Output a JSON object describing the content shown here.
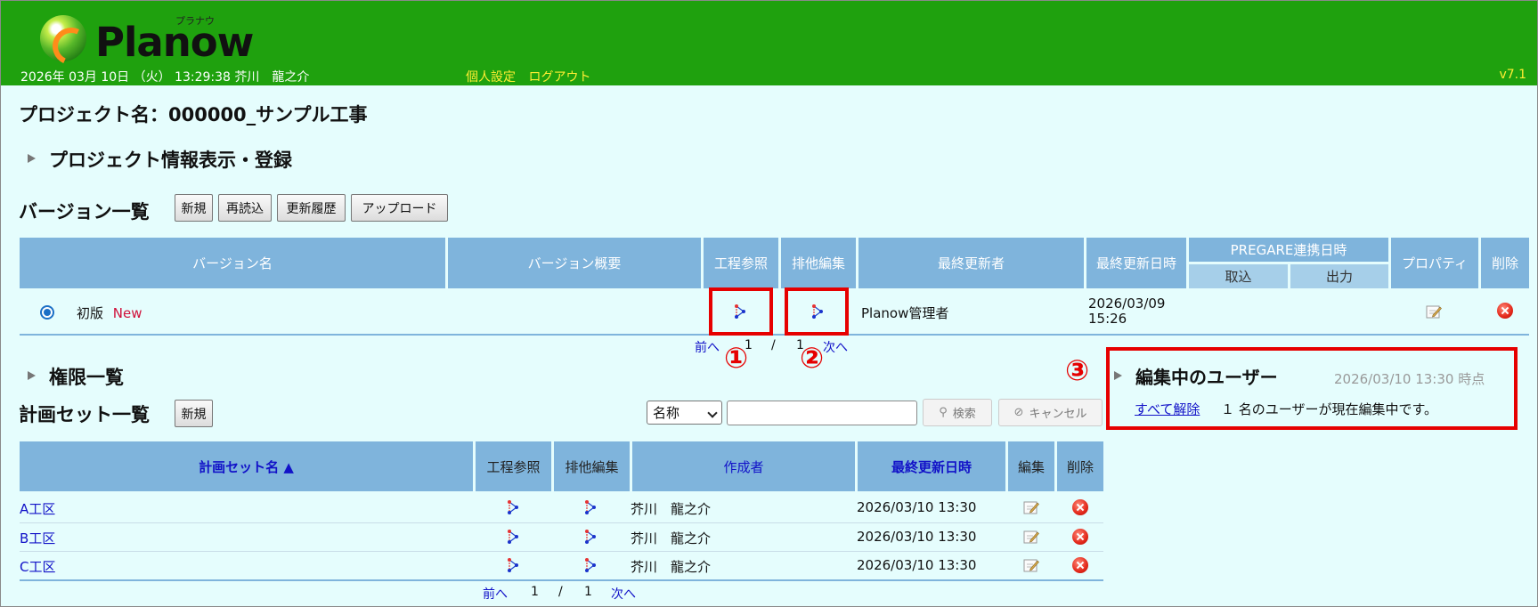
{
  "header": {
    "logo_text": "Planow",
    "logo_ruby": "プラナウ",
    "datetime_user": "2026年 03月 10日 （火） 13:29:38 芥川　龍之介",
    "link_settings": "個人設定",
    "link_logout": "ログアウト",
    "version": "v7.1"
  },
  "project": {
    "title": "プロジェクト名：000000_サンプル工事",
    "info_section": "プロジェクト情報表示・登録"
  },
  "versions": {
    "title": "バージョン一覧",
    "buttons": [
      "新規",
      "再読込",
      "更新履歴",
      "アップロード"
    ],
    "columns": {
      "name": "バージョン名",
      "summary": "バージョン概要",
      "process_ref": "工程参照",
      "exclusive_edit": "排他編集",
      "last_updater": "最終更新者",
      "last_updated": "最終更新日時",
      "pregare": "PREGARE連携日時",
      "import": "取込",
      "export": "出力",
      "property": "プロパティ",
      "delete": "削除"
    },
    "row": {
      "name": "初版",
      "badge": "New",
      "updater": "Planow管理者",
      "updated_date": "2026/03/09",
      "updated_time": "15:26"
    },
    "pager": {
      "prev": "前へ",
      "current": "1",
      "sep": "/",
      "total": "1",
      "next": "次へ"
    }
  },
  "permissions": {
    "title": "権限一覧"
  },
  "plan_sets": {
    "title": "計画セット一覧",
    "new_button": "新規",
    "search_field": "名称",
    "search_button": "検索",
    "cancel_button": "キャンセル",
    "columns": {
      "name": "計画セット名 ▲",
      "process_ref": "工程参照",
      "exclusive_edit": "排他編集",
      "creator": "作成者",
      "last_updated": "最終更新日時",
      "edit": "編集",
      "delete": "削除"
    },
    "rows": [
      {
        "name": "A工区",
        "creator": "芥川　龍之介",
        "updated": "2026/03/10 13:30"
      },
      {
        "name": "B工区",
        "creator": "芥川　龍之介",
        "updated": "2026/03/10 13:30"
      },
      {
        "name": "C工区",
        "creator": "芥川　龍之介",
        "updated": "2026/03/10 13:30"
      }
    ],
    "pager": {
      "prev": "前へ",
      "current": "1",
      "sep": "/",
      "total": "1",
      "next": "次へ"
    }
  },
  "editing_users": {
    "title": "編集中のユーザー",
    "timestamp": "2026/03/10 13:30 時点",
    "release_all": "すべて解除",
    "message": "１ 名のユーザーが現在編集中です。"
  },
  "annotations": {
    "m1": "①",
    "m2": "②",
    "m3": "③"
  },
  "icons": {
    "gantt": "gantt-chart-icon",
    "edit": "pencil-edit-icon",
    "delete": "delete-x-icon",
    "search": "magnifier-icon",
    "cancel": "cancel-circle-icon"
  },
  "colors": {
    "header_bg": "#1fa10e",
    "header_link": "#ffee33",
    "page_bg": "#e5fdfd",
    "table_header": "#7fb4dc",
    "link": "#1212c8",
    "annotation": "#e60000"
  }
}
